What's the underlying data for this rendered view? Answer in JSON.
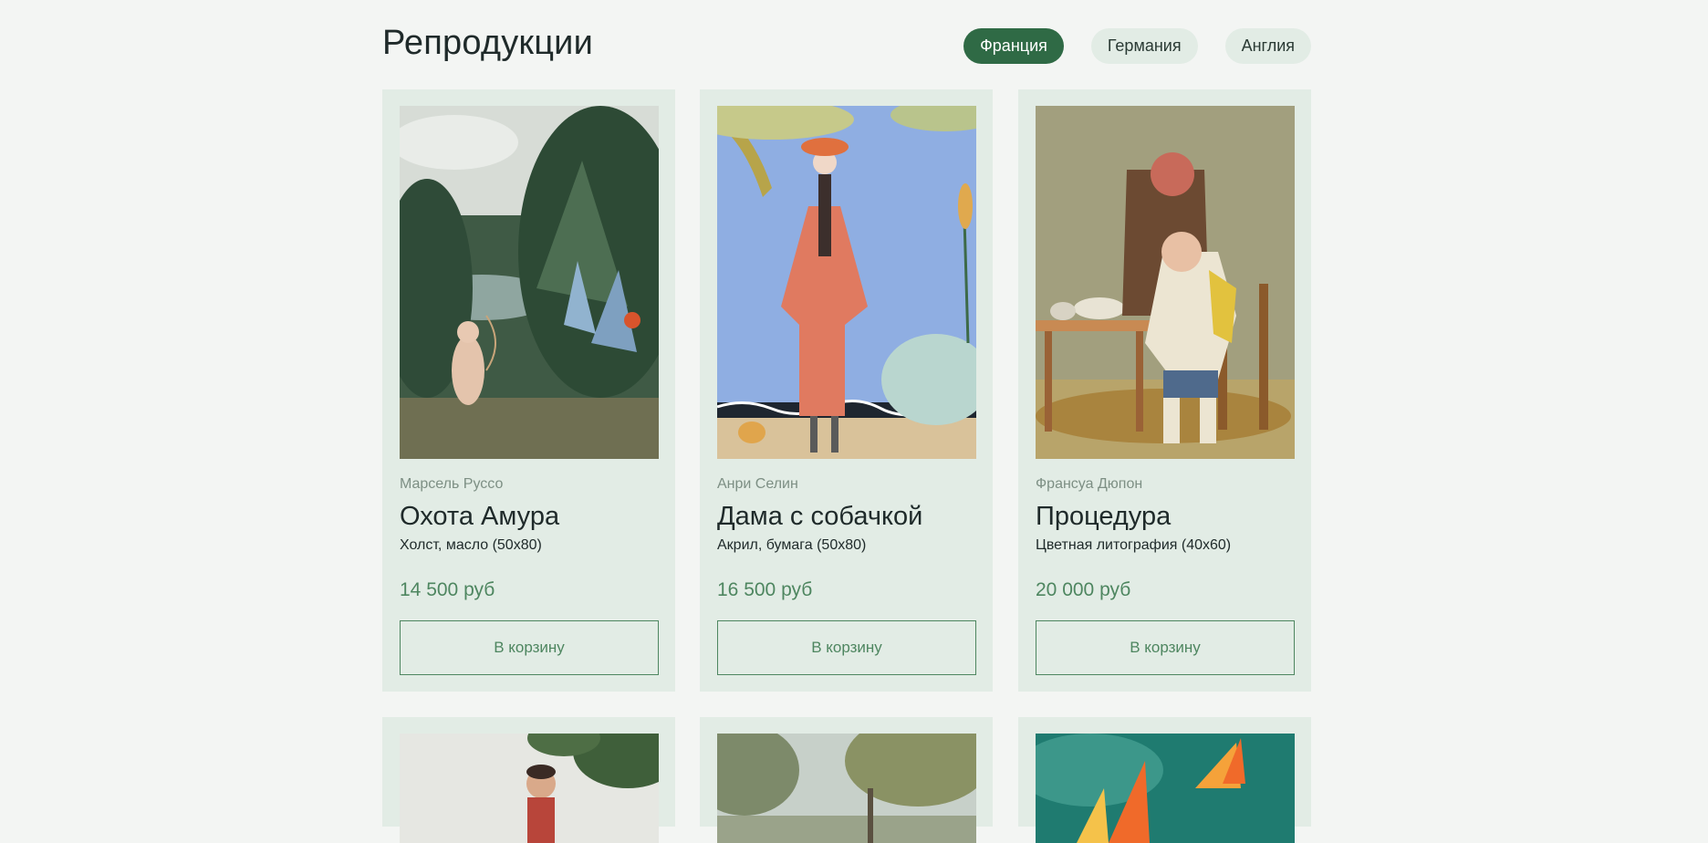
{
  "header": {
    "title": "Репродукции",
    "filters": [
      {
        "label": "Франция",
        "active": true
      },
      {
        "label": "Германия",
        "active": false
      },
      {
        "label": "Англия",
        "active": false
      }
    ]
  },
  "products": [
    {
      "author": "Марсель Руссо",
      "title": "Охота Амура",
      "medium": "Холст, масло (50x80)",
      "price": "14 500 руб",
      "button": "В корзину"
    },
    {
      "author": "Анри Селин",
      "title": "Дама с собачкой",
      "medium": "Акрил, бумага (50x80)",
      "price": "16 500 руб",
      "button": "В корзину"
    },
    {
      "author": "Франсуа Дюпон",
      "title": "Процедура",
      "medium": "Цветная литография (40x60)",
      "price": "20 000 руб",
      "button": "В корзину"
    }
  ],
  "colors": {
    "accent": "#2f6a45",
    "price": "#4e8660",
    "card_bg": "#e2ece5",
    "page_bg": "#f3f5f3"
  }
}
